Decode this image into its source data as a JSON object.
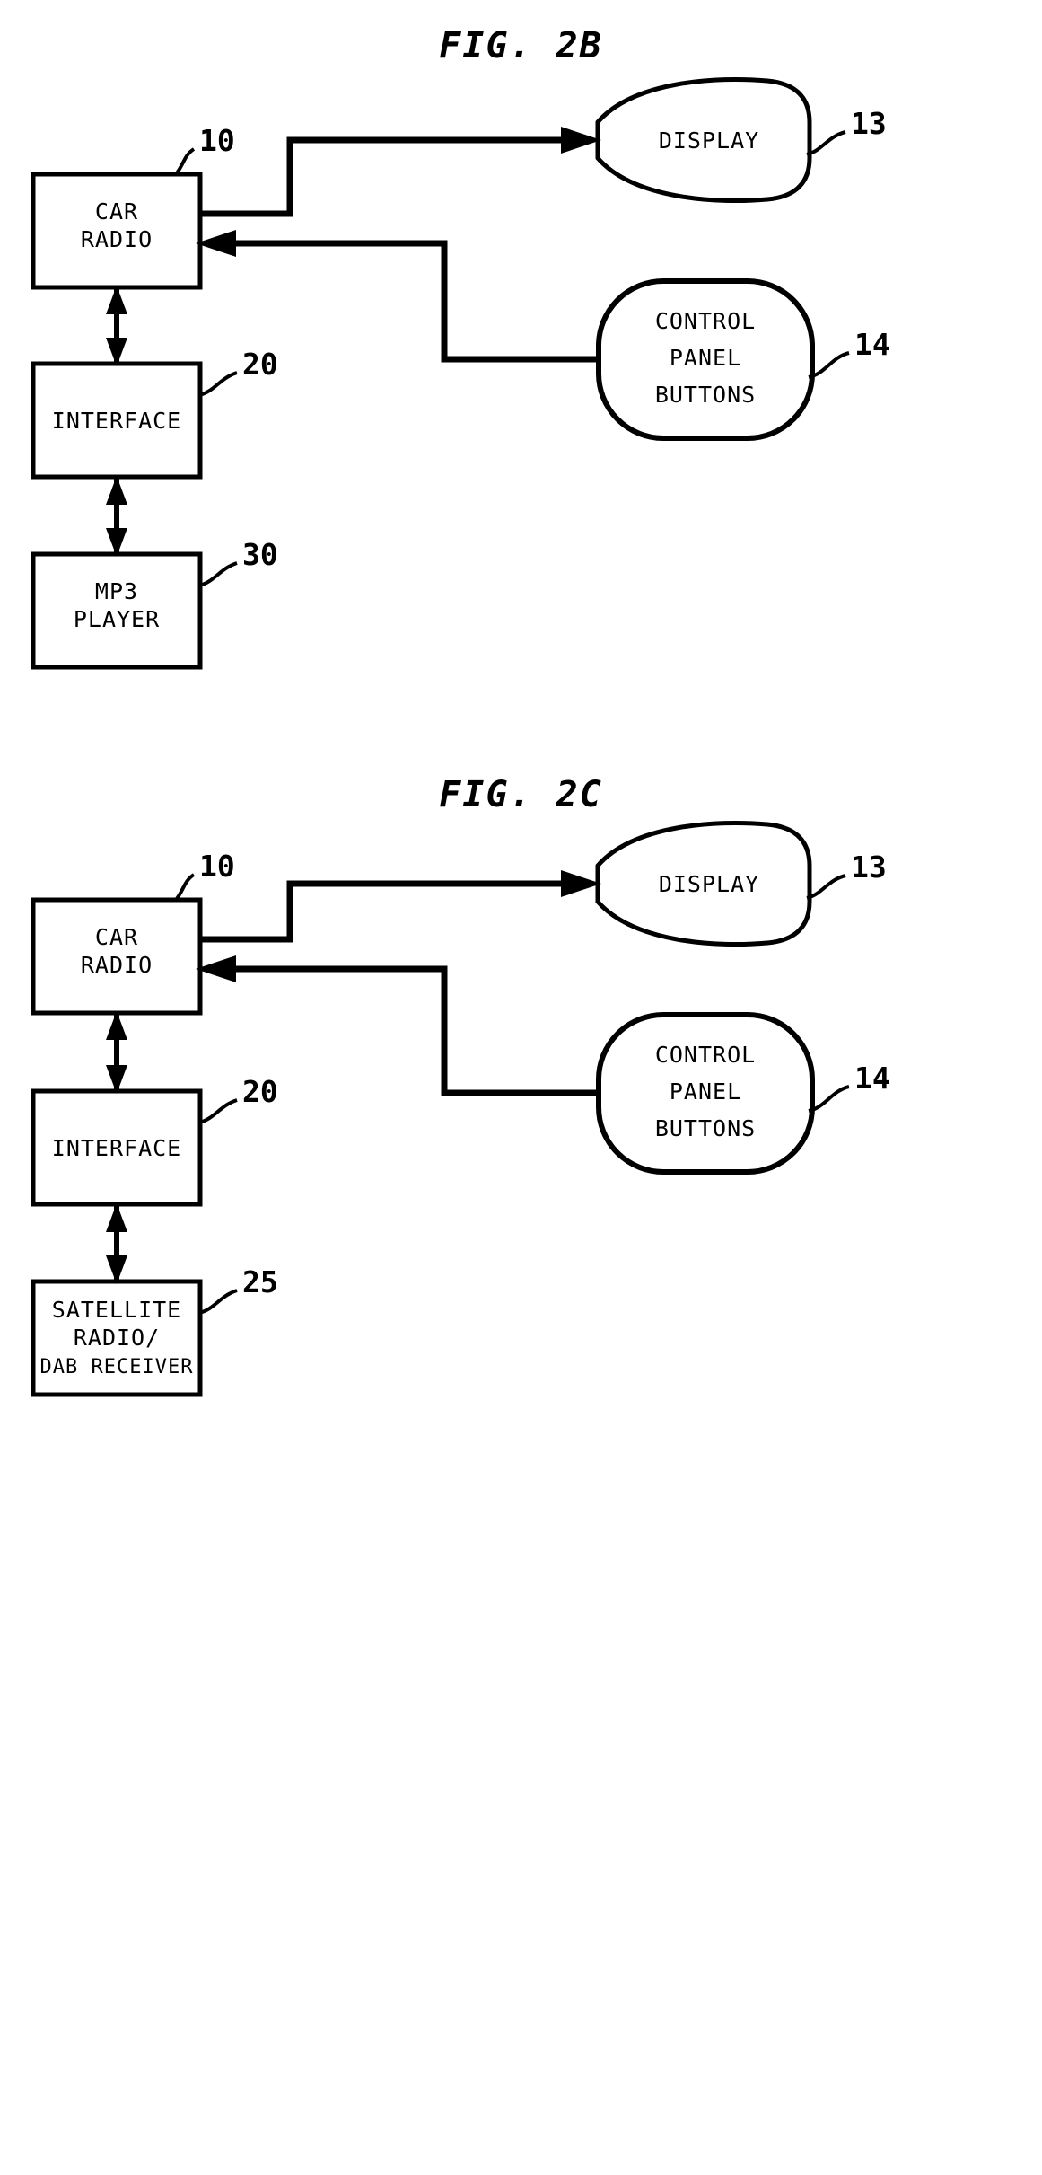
{
  "document": {
    "type": "patent-figure-sheet",
    "figures": [
      {
        "id": "fig-2b",
        "title": "FIG. 2B",
        "nodes": [
          {
            "key": "car_radio",
            "shape": "rect",
            "lines": [
              "CAR",
              "RADIO"
            ],
            "ref": "10"
          },
          {
            "key": "display",
            "shape": "leaf",
            "lines": [
              "DISPLAY"
            ],
            "ref": "13"
          },
          {
            "key": "control",
            "shape": "rounded",
            "lines": [
              "CONTROL",
              "PANEL",
              "BUTTONS"
            ],
            "ref": "14"
          },
          {
            "key": "interface",
            "shape": "rect",
            "lines": [
              "INTERFACE"
            ],
            "ref": "20"
          },
          {
            "key": "device",
            "shape": "rect",
            "lines": [
              "MP3",
              "PLAYER"
            ],
            "ref": "30"
          }
        ],
        "edges": [
          {
            "from": "car_radio",
            "to": "display",
            "arrow": "single",
            "style": "orthogonal-up"
          },
          {
            "from": "control",
            "to": "car_radio",
            "arrow": "single",
            "style": "orthogonal-left"
          },
          {
            "from": "car_radio",
            "to": "interface",
            "arrow": "double",
            "style": "vertical"
          },
          {
            "from": "interface",
            "to": "device",
            "arrow": "double",
            "style": "vertical"
          }
        ]
      },
      {
        "id": "fig-2c",
        "title": "FIG. 2C",
        "nodes": [
          {
            "key": "car_radio",
            "shape": "rect",
            "lines": [
              "CAR",
              "RADIO"
            ],
            "ref": "10"
          },
          {
            "key": "display",
            "shape": "leaf",
            "lines": [
              "DISPLAY"
            ],
            "ref": "13"
          },
          {
            "key": "control",
            "shape": "rounded",
            "lines": [
              "CONTROL",
              "PANEL",
              "BUTTONS"
            ],
            "ref": "14"
          },
          {
            "key": "interface",
            "shape": "rect",
            "lines": [
              "INTERFACE"
            ],
            "ref": "20"
          },
          {
            "key": "device",
            "shape": "rect",
            "lines": [
              "SATELLITE",
              "RADIO/",
              "DAB RECEIVER"
            ],
            "ref": "25"
          }
        ],
        "edges": [
          {
            "from": "car_radio",
            "to": "display",
            "arrow": "single",
            "style": "orthogonal-up"
          },
          {
            "from": "control",
            "to": "car_radio",
            "arrow": "single",
            "style": "orthogonal-left"
          },
          {
            "from": "car_radio",
            "to": "interface",
            "arrow": "double",
            "style": "vertical"
          },
          {
            "from": "interface",
            "to": "device",
            "arrow": "double",
            "style": "vertical"
          }
        ]
      }
    ],
    "colors": {
      "ink": "#000000",
      "paper": "#ffffff"
    }
  }
}
